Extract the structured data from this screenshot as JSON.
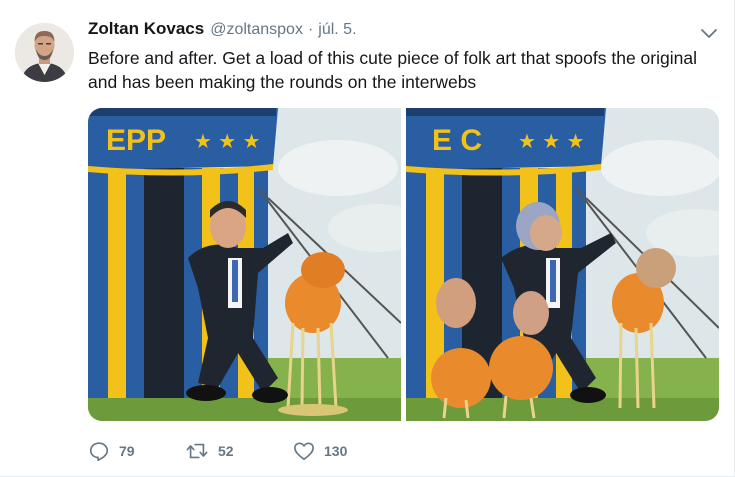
{
  "tweet": {
    "author_name": "Zoltan Kovacs",
    "handle": "@zoltanspox",
    "separator": "·",
    "date": "júl. 5.",
    "text_line1": "Before and after. Get a load of this cute piece of folk art that spoofs the original",
    "text_line2": "and has been making the rounds on the interwebs",
    "avatar_icon": "user-avatar",
    "caret_icon": "chevron-down-icon"
  },
  "media": {
    "left_banner": "EPP",
    "right_banner": "E C",
    "left_stars": "★ ★ ★",
    "right_stars": "★ ★ ★"
  },
  "actions": {
    "reply_icon": "reply-icon",
    "reply_count": "79",
    "retweet_icon": "retweet-icon",
    "retweet_count": "52",
    "like_icon": "heart-icon",
    "like_count": "130"
  },
  "colors": {
    "text": "#14171a",
    "secondary": "#657786",
    "border": "#e6ecf0",
    "tent_blue": "#2a5ea3",
    "tent_yellow": "#f2c21a",
    "grass": "#7fb04a",
    "sky": "#dfe7ea"
  }
}
